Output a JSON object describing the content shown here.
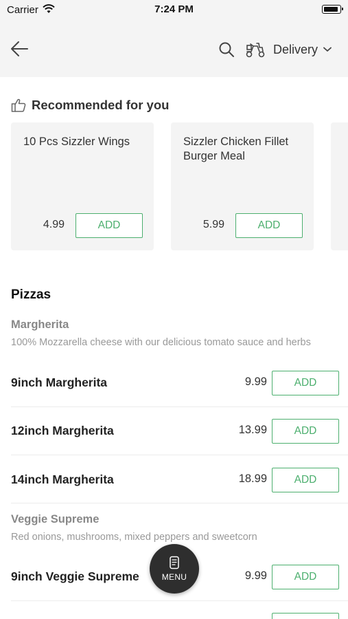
{
  "status_bar": {
    "carrier": "Carrier",
    "time": "7:24 PM"
  },
  "header": {
    "back_icon": "arrow-left-icon",
    "search_icon": "search-icon",
    "scooter_icon": "scooter-icon",
    "order_type": "Delivery",
    "chevron_icon": "chevron-down-icon"
  },
  "recommended": {
    "title": "Recommended for you",
    "icon": "thumbs-up-icon",
    "items": [
      {
        "name": "10 Pcs Sizzler Wings",
        "price": "4.99",
        "add_label": "ADD"
      },
      {
        "name": "Sizzler Chicken Fillet Burger Meal",
        "price": "5.99",
        "add_label": "ADD"
      }
    ]
  },
  "section": {
    "title": "Pizzas"
  },
  "categories": [
    {
      "name": "Margherita",
      "description": "100% Mozzarella cheese with our delicious tomato sauce and herbs",
      "items": [
        {
          "name": "9inch Margherita",
          "price": "9.99",
          "add_label": "ADD"
        },
        {
          "name": "12inch Margherita",
          "price": "13.99",
          "add_label": "ADD"
        },
        {
          "name": "14inch Margherita",
          "price": "18.99",
          "add_label": "ADD"
        }
      ]
    },
    {
      "name": "Veggie Supreme",
      "description": "Red onions, mushrooms, mixed peppers and sweetcorn",
      "items": [
        {
          "name": "9inch Veggie Supreme",
          "price": "9.99",
          "add_label": "ADD"
        }
      ]
    }
  ],
  "menu_button": {
    "label": "MENU",
    "icon": "menu-book-icon"
  },
  "colors": {
    "accent": "#4caf6e",
    "header_bg": "#f4f4f4",
    "fab_bg": "#2e2e2e"
  }
}
